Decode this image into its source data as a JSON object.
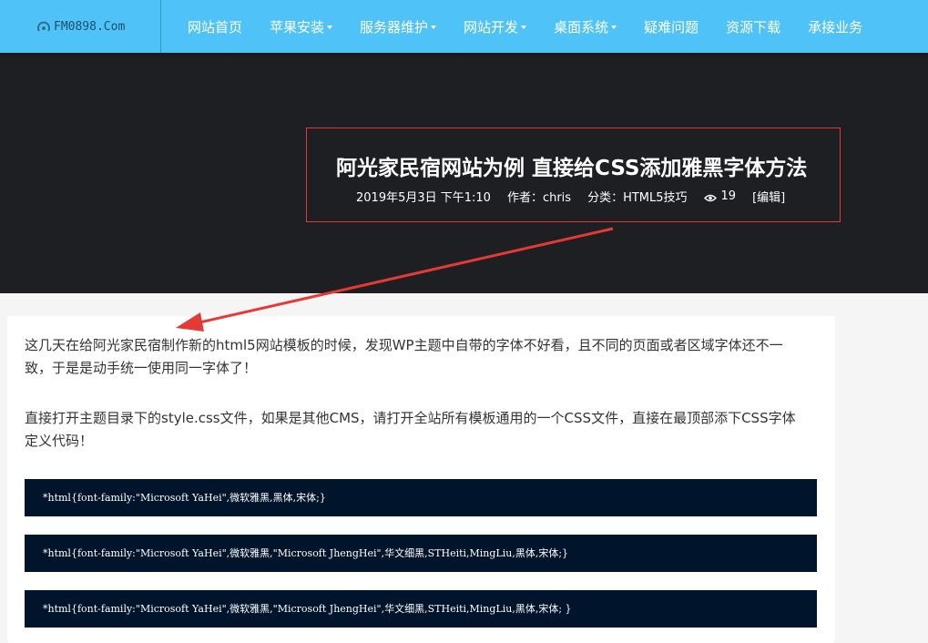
{
  "site": {
    "logo_text": "FM0898.Com",
    "logo_icon": "site-logo-icon"
  },
  "nav": {
    "items": [
      {
        "label": "网站首页",
        "has_dropdown": false
      },
      {
        "label": "苹果安装",
        "has_dropdown": true
      },
      {
        "label": "服务器维护",
        "has_dropdown": true
      },
      {
        "label": "网站开发",
        "has_dropdown": true
      },
      {
        "label": "桌面系统",
        "has_dropdown": true
      },
      {
        "label": "疑难问题",
        "has_dropdown": false
      },
      {
        "label": "资源下载",
        "has_dropdown": false
      },
      {
        "label": "承接业务",
        "has_dropdown": false
      }
    ]
  },
  "post": {
    "title": "阿光家民宿网站为例 直接给CSS添加雅黑字体方法",
    "date": "2019年5月3日 下午1:10",
    "author": "作者：chris",
    "category": "分类：HTML5技巧",
    "views": "19",
    "views_icon": "eye-icon",
    "edit_label": "[编辑]"
  },
  "content": {
    "paragraph_1": "这几天在给阿光家民宿制作新的html5网站模板的时候，发现WP主题中自带的字体不好看，且不同的页面或者区域字体还不一致，于是是动手统一使用同一字体了！",
    "paragraph_2": "直接打开主题目录下的style.css文件，如果是其他CMS，请打开全站所有模板通用的一个CSS文件，直接在最顶部添下CSS字体定义代码！",
    "code_1": "*html{font-family:\"Microsoft YaHei\",微软雅黑,黑体,宋体;}",
    "code_2": "*html{font-family:\"Microsoft YaHei\",微软雅黑,\"Microsoft JhengHei\",华文细黑,STHeiti,MingLiu,黑体,宋体;}",
    "code_3": "*html{font-family:\"Microsoft YaHei\",微软雅黑,\"Microsoft JhengHei\",华文细黑,STHeiti,MingLiu,黑体,宋体; }"
  },
  "colors": {
    "navbar": "#4fc3f7",
    "hero": "#1e1f22",
    "highlight_box": "#e53935",
    "annotation_arrow": "#e53935",
    "code_background": "#00152b"
  }
}
